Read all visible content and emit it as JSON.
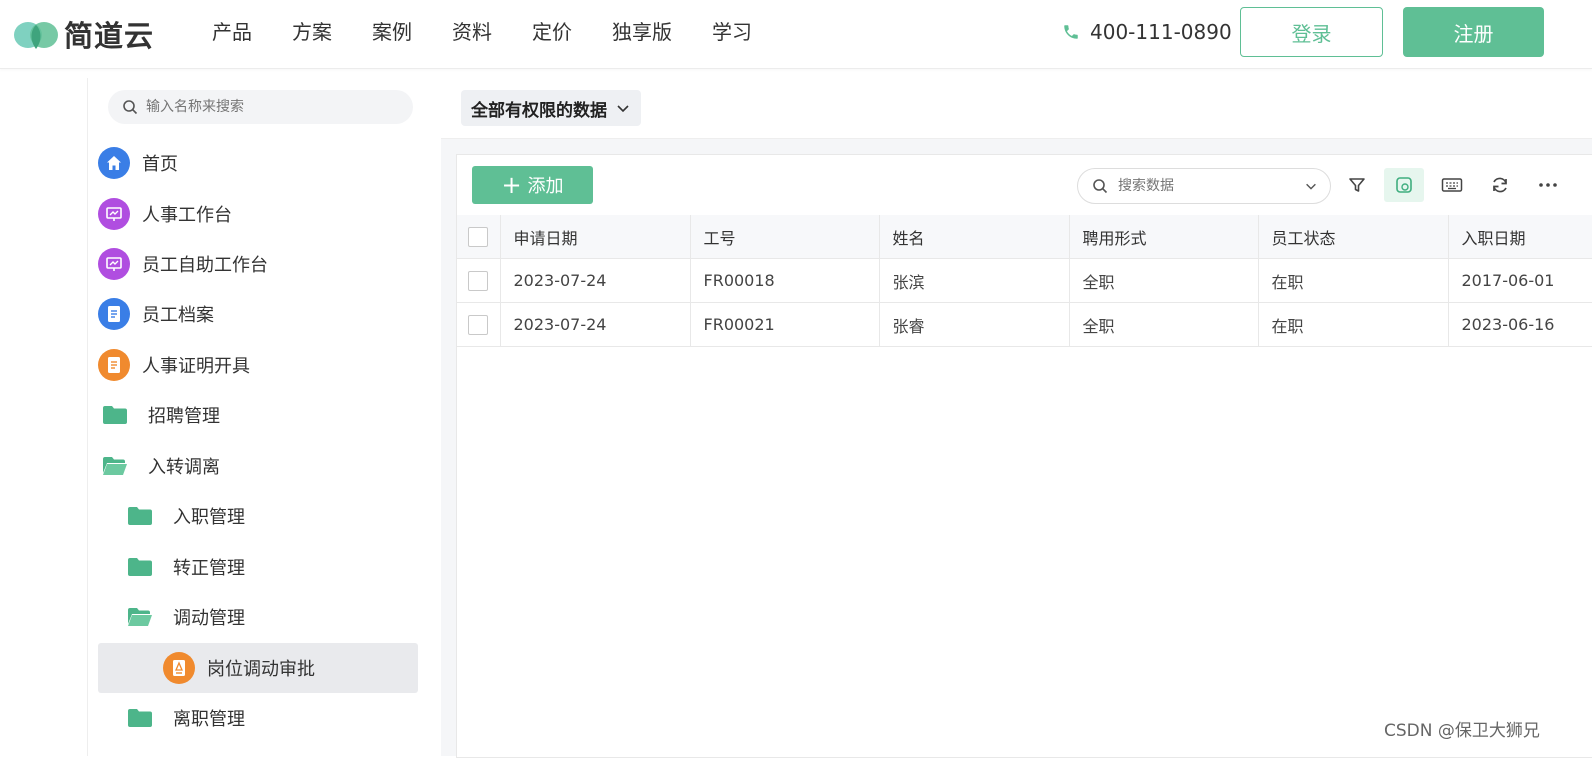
{
  "brand": {
    "name": "简道云",
    "primary": "#5fbf95"
  },
  "nav": [
    "产品",
    "方案",
    "案例",
    "资料",
    "定价",
    "独享版",
    "学习"
  ],
  "phone": "400-111-0890",
  "auth": {
    "login": "登录",
    "register": "注册"
  },
  "sidebar": {
    "search_placeholder": "输入名称来搜索",
    "items": [
      {
        "label": "首页",
        "icon": "home-icon",
        "color": "#3a7ee6"
      },
      {
        "label": "人事工作台",
        "icon": "dashboard-icon",
        "color": "#b04ee0"
      },
      {
        "label": "员工自助工作台",
        "icon": "dashboard-icon",
        "color": "#b04ee0"
      },
      {
        "label": "员工档案",
        "icon": "document-icon",
        "color": "#3a7ee6"
      },
      {
        "label": "人事证明开具",
        "icon": "document-icon",
        "color": "#f08a2e"
      },
      {
        "label": "招聘管理",
        "icon": "folder-icon"
      },
      {
        "label": "入转调离",
        "icon": "folder-open-icon"
      },
      {
        "label": "入职管理",
        "icon": "folder-icon"
      },
      {
        "label": "转正管理",
        "icon": "folder-icon"
      },
      {
        "label": "调动管理",
        "icon": "folder-open-icon"
      },
      {
        "label": "岗位调动审批",
        "icon": "approval-icon",
        "color": "#f08a2e",
        "active": true
      },
      {
        "label": "离职管理",
        "icon": "folder-icon"
      }
    ]
  },
  "main": {
    "permission_filter": "全部有权限的数据",
    "add_button": "添加",
    "search_placeholder": "搜索数据",
    "table": {
      "columns": [
        "申请日期",
        "工号",
        "姓名",
        "聘用形式",
        "员工状态",
        "入职日期"
      ],
      "rows": [
        [
          "2023-07-24",
          "FR00018",
          "张滨",
          "全职",
          "在职",
          "2017-06-01"
        ],
        [
          "2023-07-24",
          "FR00021",
          "张睿",
          "全职",
          "在职",
          "2023-06-16"
        ]
      ]
    }
  },
  "watermark": "CSDN @保卫大狮兄"
}
